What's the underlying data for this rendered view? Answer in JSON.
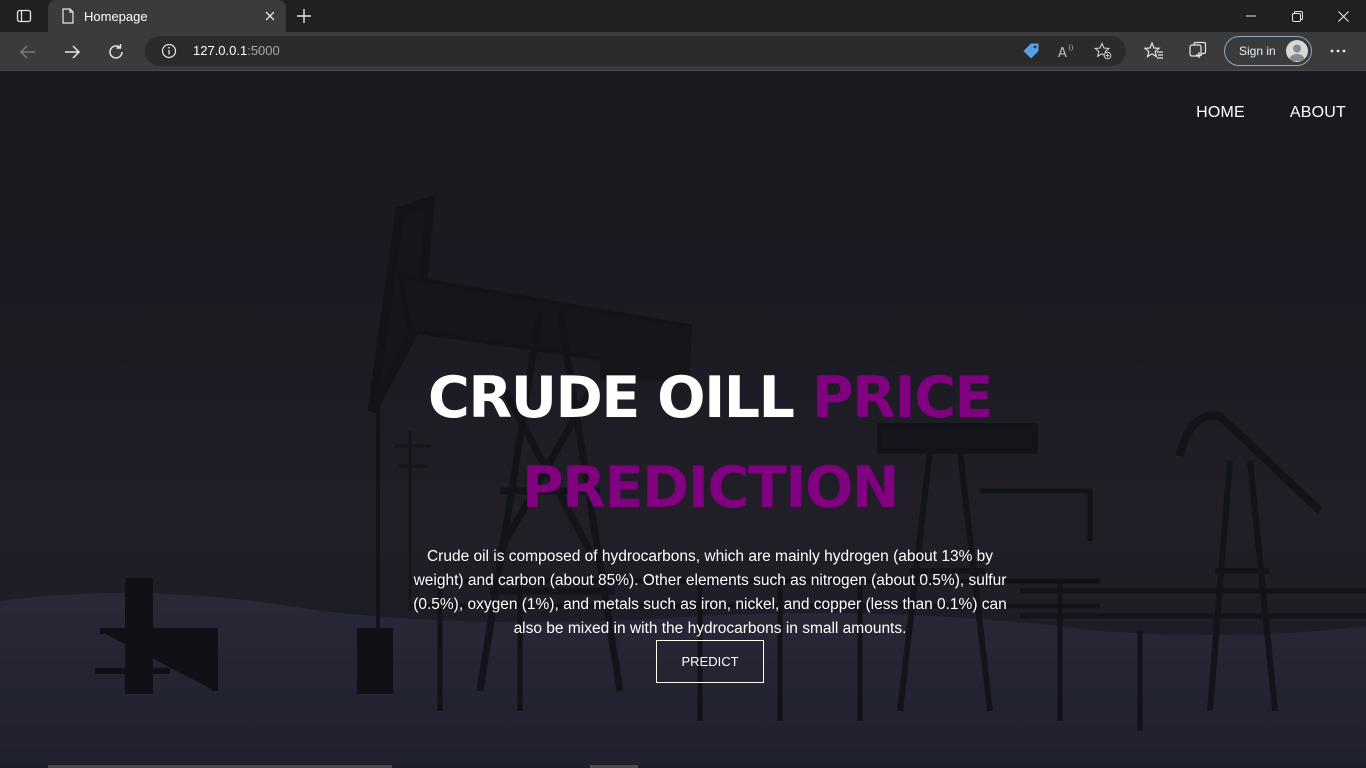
{
  "browser": {
    "tab_title": "Homepage",
    "url_host": "127.0.0.1",
    "url_port": ":5000",
    "sign_in_label": "Sign in",
    "icons": [
      "tab-actions-icon",
      "page-icon",
      "close-tab-icon",
      "new-tab-icon",
      "minimize-icon",
      "restore-icon",
      "close-window-icon",
      "back-icon",
      "forward-icon",
      "refresh-icon",
      "info-icon",
      "coupon-tag-icon",
      "read-aloud-icon",
      "add-favorite-icon",
      "favorites-icon",
      "collections-icon",
      "profile-avatar-icon",
      "more-menu-icon"
    ]
  },
  "page": {
    "nav": {
      "home": "HOME",
      "about": "ABOUT"
    },
    "hero": {
      "title_white": "CRUDE OILL",
      "title_accent": "PRICE PREDICTION",
      "description": "Crude oil is composed of hydrocarbons, which are mainly hydrogen (about 13% by weight) and carbon (about 85%). Other elements such as nitrogen (about 0.5%), sulfur (0.5%), oxygen (1%), and metals such as iron, nickel, and copper (less than 0.1%) can also be mixed in with the hydrocarbons in small amounts.",
      "button": "PREDICT"
    },
    "colors": {
      "accent": "#800080",
      "text": "#ffffff"
    }
  }
}
